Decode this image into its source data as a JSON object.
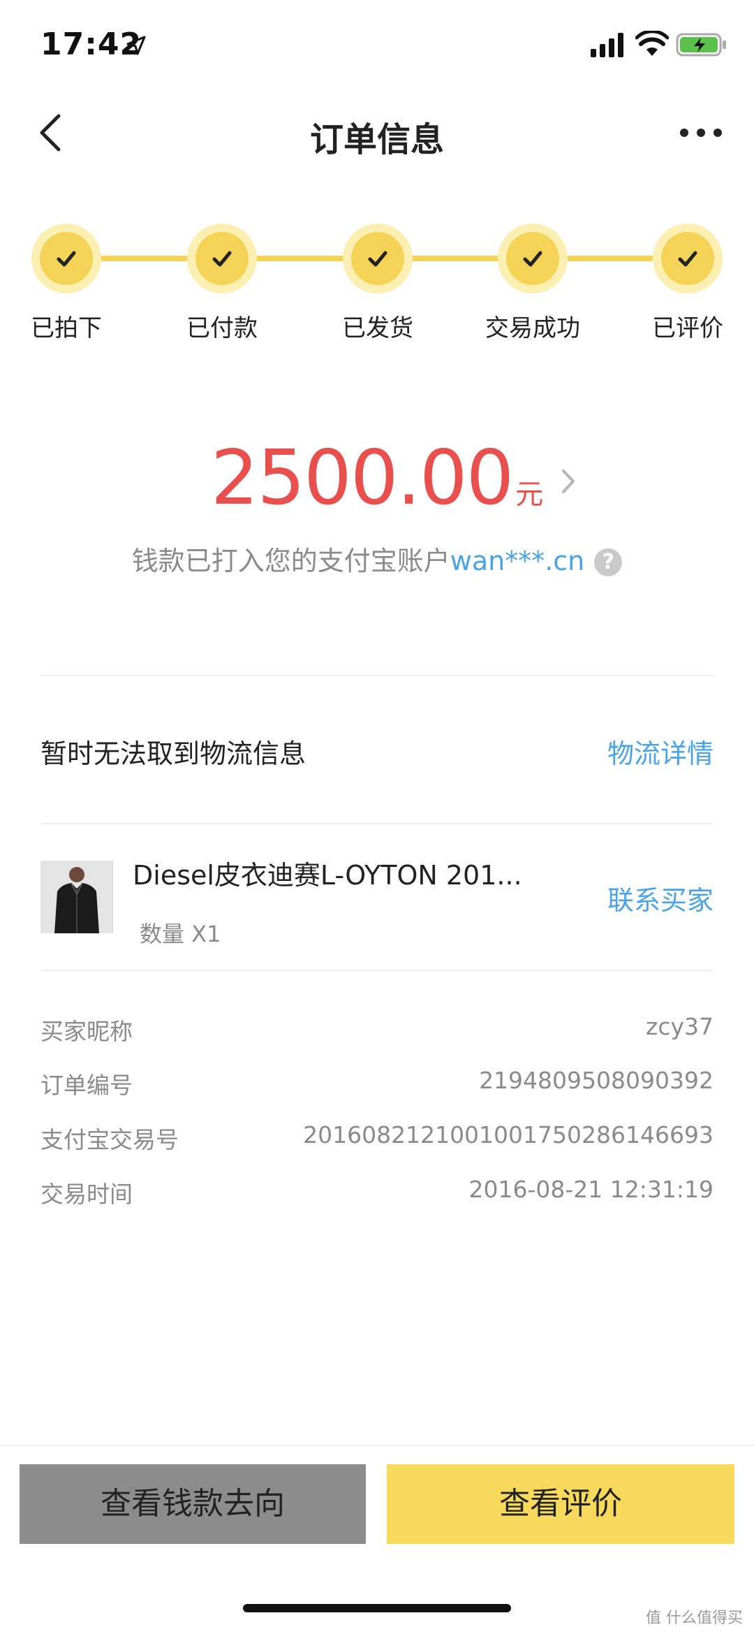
{
  "status_bar": {
    "time": "17:42"
  },
  "nav": {
    "title": "订单信息"
  },
  "steps": [
    {
      "label": "已拍下"
    },
    {
      "label": "已付款"
    },
    {
      "label": "已发货"
    },
    {
      "label": "交易成功"
    },
    {
      "label": "已评价"
    }
  ],
  "payment": {
    "amount": "2500.00",
    "unit": "元",
    "note": "钱款已打入您的支付宝账户",
    "account": "wan***.cn",
    "help_symbol": "?"
  },
  "logistics": {
    "status_text": "暂时无法取到物流信息",
    "link_label": "物流详情"
  },
  "product": {
    "title": "Diesel皮衣迪赛L-OYTON 201...",
    "quantity": "数量 X1",
    "contact_label": "联系买家"
  },
  "order_info": [
    {
      "label": "买家昵称",
      "value": "zcy37"
    },
    {
      "label": "订单编号",
      "value": "2194809508090392"
    },
    {
      "label": "支付宝交易号",
      "value": "2016082121001001750286146693"
    },
    {
      "label": "交易时间",
      "value": "2016-08-21 12:31:19"
    }
  ],
  "actions": {
    "view_funds": "查看钱款去向",
    "view_review": "查看评价"
  },
  "watermark": "值 什么值得买",
  "colors": {
    "accent_yellow": "#f4d356",
    "price_red": "#e8504d",
    "link_blue": "#4aa3e6",
    "muted_text": "#8a8a8a"
  }
}
